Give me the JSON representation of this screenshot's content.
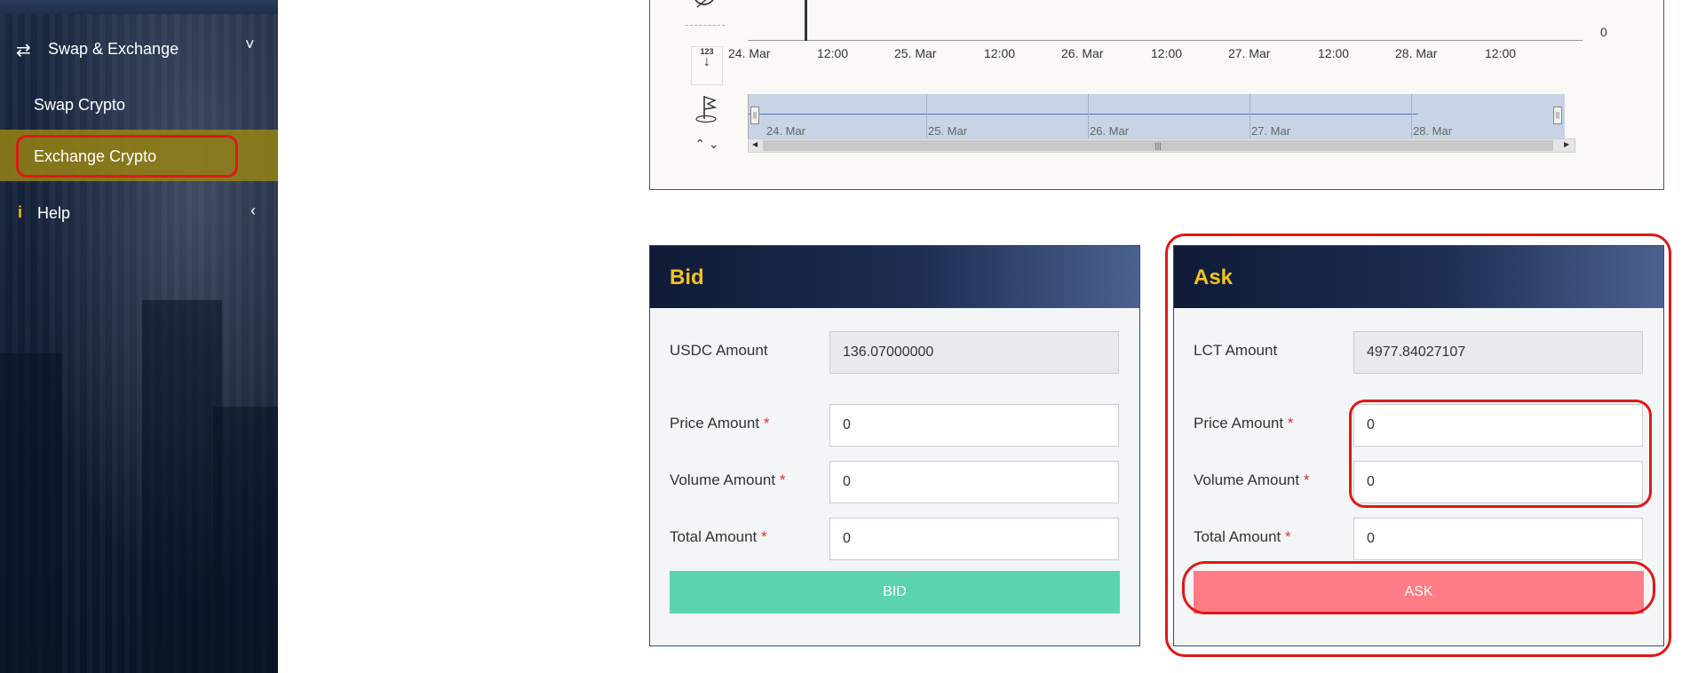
{
  "sidebar": {
    "items": [
      {
        "label": "Swap & Exchange",
        "icon": "arrows-exchange-icon",
        "chevron": "˅"
      },
      {
        "label": "Swap Crypto"
      },
      {
        "label": "Exchange Crypto"
      },
      {
        "label": "Help",
        "icon": "info-icon",
        "chevron": "‹"
      }
    ]
  },
  "chart": {
    "x_ticks": [
      "24. Mar",
      "12:00",
      "25. Mar",
      "12:00",
      "26. Mar",
      "12:00",
      "27. Mar",
      "12:00",
      "28. Mar",
      "12:00"
    ],
    "y_label_right": "0",
    "navigator_labels": [
      "24. Mar",
      "25. Mar",
      "26. Mar",
      "27. Mar",
      "28. Mar"
    ],
    "tool_icons": [
      "hide-icon",
      "number-format-icon",
      "flag-icon",
      "up-down-arrows-icon"
    ],
    "tool_text": {
      "number": "123"
    }
  },
  "bid": {
    "title": "Bid",
    "fields": [
      {
        "label": "USDC Amount",
        "required": false,
        "value": "136.07000000",
        "readonly": true
      },
      {
        "label": "Price Amount",
        "required": true,
        "value": "0"
      },
      {
        "label": "Volume Amount",
        "required": true,
        "value": "0"
      },
      {
        "label": "Total Amount",
        "required": true,
        "value": "0"
      }
    ],
    "button_label": "BID"
  },
  "ask": {
    "title": "Ask",
    "fields": [
      {
        "label": "LCT Amount",
        "required": false,
        "value": "4977.84027107",
        "readonly": true
      },
      {
        "label": "Price Amount",
        "required": true,
        "value": "0"
      },
      {
        "label": "Volume Amount",
        "required": true,
        "value": "0"
      },
      {
        "label": "Total Amount",
        "required": true,
        "value": "0"
      }
    ],
    "button_label": "ASK"
  },
  "required_mark": "*",
  "colors": {
    "accent_gold": "#f4c21c",
    "bid_button": "#5bd4ae",
    "ask_button": "#ff7b85",
    "highlight": "#e01818",
    "sidebar_active": "#968214"
  }
}
